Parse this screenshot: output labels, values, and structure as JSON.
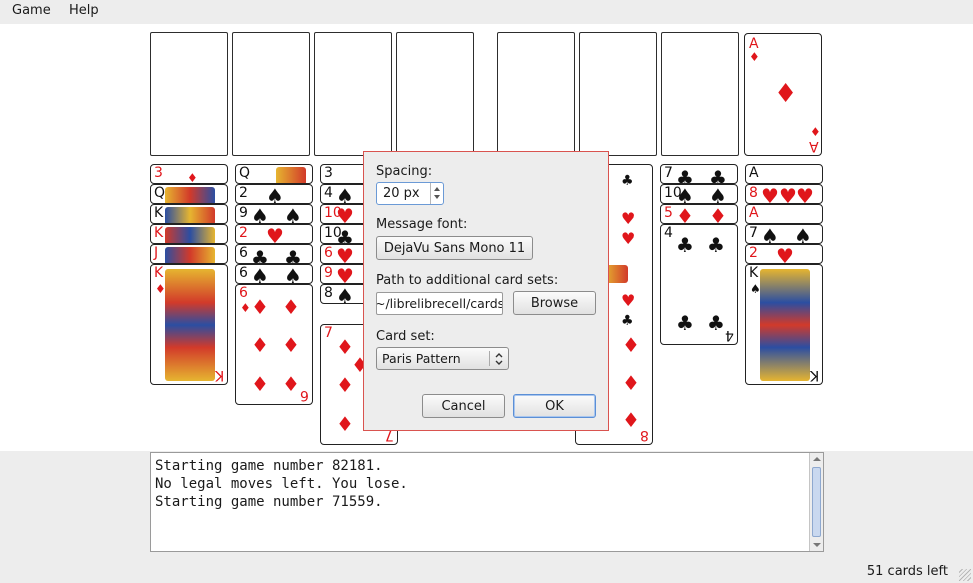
{
  "menu": {
    "game": "Game",
    "help": "Help"
  },
  "foundation": {
    "ace_rank": "A",
    "ace_suit": "♦"
  },
  "tableau": {
    "col1": [
      {
        "rank": "3",
        "suit": "♦",
        "red": true
      },
      {
        "rank": "Q",
        "suit": "♥",
        "red": false
      },
      {
        "rank": "K",
        "suit": "♠",
        "red": false
      },
      {
        "rank": "K",
        "suit": "♥",
        "red": true
      },
      {
        "rank": "J",
        "suit": "♦",
        "red": true
      },
      {
        "rank": "K",
        "suit": "♦",
        "red": true
      }
    ],
    "col2": [
      {
        "rank": "Q",
        "suit": "♣",
        "red": false
      },
      {
        "rank": "2",
        "suit": "♠",
        "red": false
      },
      {
        "rank": "9",
        "suit": "♠",
        "red": false
      },
      {
        "rank": "2",
        "suit": "♥",
        "red": true
      },
      {
        "rank": "6",
        "suit": "♣",
        "red": false
      },
      {
        "rank": "6",
        "suit": "♠",
        "red": false
      },
      {
        "rank": "6",
        "suit": "♦",
        "red": true
      }
    ],
    "col3": [
      {
        "rank": "3",
        "suit": "♠",
        "red": false
      },
      {
        "rank": "4",
        "suit": "♠",
        "red": false
      },
      {
        "rank": "10",
        "suit": "♥",
        "red": true
      },
      {
        "rank": "10",
        "suit": "♣",
        "red": false
      },
      {
        "rank": "6",
        "suit": "♥",
        "red": true
      },
      {
        "rank": "9",
        "suit": "♥",
        "red": true
      },
      {
        "rank": "8",
        "suit": "♠",
        "red": false
      },
      {
        "rank": "7",
        "suit": "♦",
        "red": true
      }
    ],
    "col6_bottom": {
      "rank": "8",
      "suit": "♦",
      "red": true
    },
    "col7": [
      {
        "rank": "7",
        "suit": "♣",
        "red": false
      },
      {
        "rank": "10",
        "suit": "♠",
        "red": false
      },
      {
        "rank": "5",
        "suit": "♠",
        "red": true
      },
      {
        "rank": "4",
        "suit": "♣",
        "red": false
      }
    ],
    "col8": [
      {
        "rank": "A",
        "suit": "♥",
        "red": false
      },
      {
        "rank": "8",
        "suit": "♥",
        "red": true
      },
      {
        "rank": "A",
        "suit": "♦",
        "red": true
      },
      {
        "rank": "7",
        "suit": "♠",
        "red": false
      },
      {
        "rank": "2",
        "suit": "♥",
        "red": true
      },
      {
        "rank": "K",
        "suit": "♠",
        "red": false
      }
    ]
  },
  "dialog": {
    "spacing_label": "Spacing:",
    "spacing_value": "20 px",
    "font_label": "Message font:",
    "font_value": "DejaVu Sans Mono 11",
    "path_label": "Path to additional card sets:",
    "path_value": "~/librelibrecell/cards",
    "browse": "Browse",
    "cardset_label": "Card set:",
    "cardset_value": "Paris Pattern",
    "cancel": "Cancel",
    "ok": "OK"
  },
  "log": [
    "Starting game number 82181.",
    "No legal moves left. You lose.",
    "Starting game number 71559."
  ],
  "status": "51 cards left",
  "colors": {
    "red_suit": "#e0161b",
    "dialog_border": "#d9534f"
  }
}
